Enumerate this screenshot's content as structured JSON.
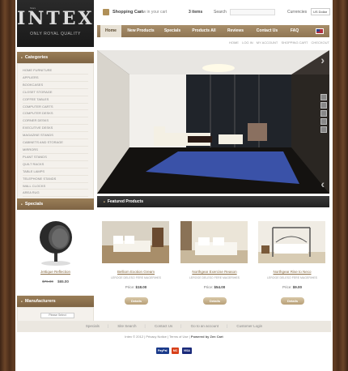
{
  "brand": {
    "small": "Stors",
    "name": "INTEX",
    "tagline": "ONLY ROYAL QUALITY"
  },
  "topbar": {
    "cart_title": "Shopping Cart",
    "cart_text": "now in your cart",
    "cart_count": "3 items",
    "search_label": "Search",
    "currency_label": "Currencies",
    "currency_value": "US Dollar"
  },
  "nav": {
    "items": [
      {
        "label": "Home"
      },
      {
        "label": "New Products"
      },
      {
        "label": "Specials"
      },
      {
        "label": "Products All"
      },
      {
        "label": "Reviews"
      },
      {
        "label": "Contact Us"
      },
      {
        "label": "FAQ"
      }
    ]
  },
  "breadcrumbs": [
    "HOME",
    "LOG IN",
    "MY ACCOUNT",
    "SHOPPING CART",
    "CHECKOUT"
  ],
  "sidebar": {
    "categories_title": "Categories",
    "categories": [
      "HOME FURNITURE",
      "APPLIERS",
      "BOOKCASES",
      "CLOSET STORAGE",
      "COFFEE TABLES",
      "COMPUTER CARTS",
      "COMPUTER DESKS",
      "CORNER DESKS",
      "EXECUTIVE DESKS",
      "MAGAZINE STANDS",
      "CABINETS AND STORAGE",
      "MIRRORS",
      "PLANT STANDS",
      "QUILT RACKS",
      "TABLE LAMPS",
      "TELEPHONE STANDS",
      "WALL CLOCKS",
      "AREA RUG",
      "DRAFTING / PRESENTATION"
    ],
    "specials_title": "Specials",
    "special": {
      "name": "Jettique Reflection",
      "old_price": "$76.00",
      "new_price": "$65.00"
    },
    "manufacturers_title": "Manufacturers",
    "manufacturers_select": "Please Select"
  },
  "featured": {
    "title": "Featured Products",
    "products": [
      {
        "name": "Belliom Exotion Gream",
        "desc": "LEROGE DELESO FERE MAGERIHES",
        "price_label": "Price:",
        "price": "$18.00",
        "button": "Details"
      },
      {
        "name": "Northgear Exercise Reason",
        "desc": "LEROGE DELESO FERE MAGERIHES",
        "price_label": "Price:",
        "price": "$54.00",
        "button": "Details"
      },
      {
        "name": "Northgear Rise to Neco",
        "desc": "LEROGE DELESO FERE MAGERIHES",
        "price_label": "Price:",
        "price": "$9.00",
        "button": "Details"
      }
    ]
  },
  "footer": {
    "links": [
      "Specials",
      "Site Search",
      "Contact Us",
      "Go to an account",
      "Customer Login"
    ],
    "copyright": "Intex © 2012",
    "privacy": "Privacy Notice",
    "terms": "Terms of Use",
    "powered": "Powered by Zen Cart",
    "payments": [
      "PayPal",
      "MC",
      "VISA"
    ]
  },
  "colors": {
    "accent": "#9a7e58",
    "dark": "#222222",
    "link": "#8a6d45",
    "frame": "#5e3b22"
  }
}
